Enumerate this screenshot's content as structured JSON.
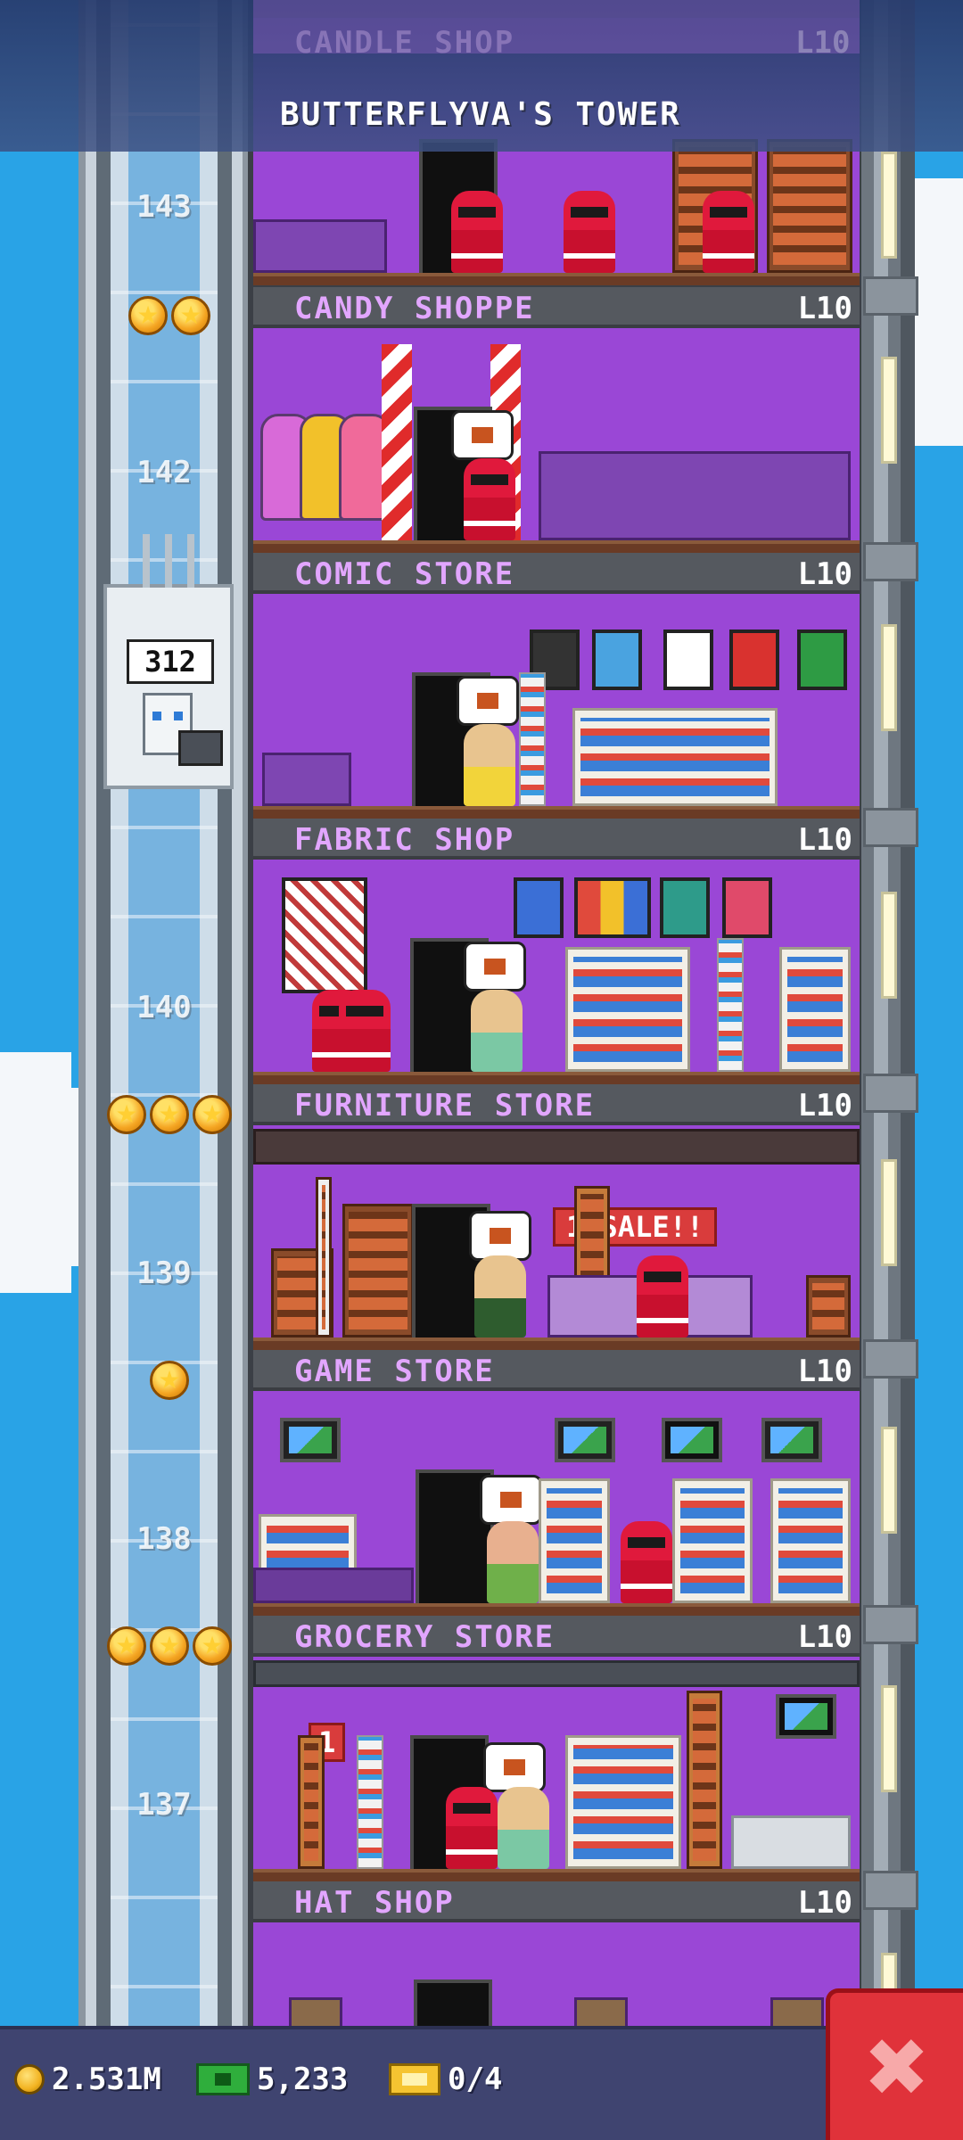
{
  "header": {
    "title": "BUTTERFLYVA'S TOWER",
    "faded_floor_name": "CANDLE SHOP",
    "faded_floor_level": "L10"
  },
  "floors": [
    {
      "name": "CANDY SHOPPE",
      "level": "L10"
    },
    {
      "name": "COMIC STORE",
      "level": "L10"
    },
    {
      "name": "FABRIC SHOP",
      "level": "L10"
    },
    {
      "name": "FURNITURE STORE",
      "level": "L10"
    },
    {
      "name": "GAME STORE",
      "level": "L10"
    },
    {
      "name": "GROCERY STORE",
      "level": "L10"
    },
    {
      "name": "HAT SHOP",
      "level": "L10"
    }
  ],
  "shaft_floor_numbers": [
    "143",
    "142",
    "140",
    "139",
    "138",
    "137"
  ],
  "elevator": {
    "counter": "312"
  },
  "floor_stars": [
    2,
    0,
    0,
    3,
    1,
    3
  ],
  "sale_sign": "1  SALE!!",
  "grocery_sign": "1",
  "status": {
    "coins": "2.531M",
    "bux": "5,233",
    "tickets": "0/4"
  },
  "icons": [
    "coin-icon",
    "bux-icon",
    "ticket-icon",
    "close-icon",
    "star-icon"
  ],
  "colors": {
    "sky": "#29a3e6",
    "floor_purple": "#9a47d6",
    "label_pink": "#e2a6ff",
    "close_red": "#e0323a",
    "status_bar": "#3f4470"
  }
}
